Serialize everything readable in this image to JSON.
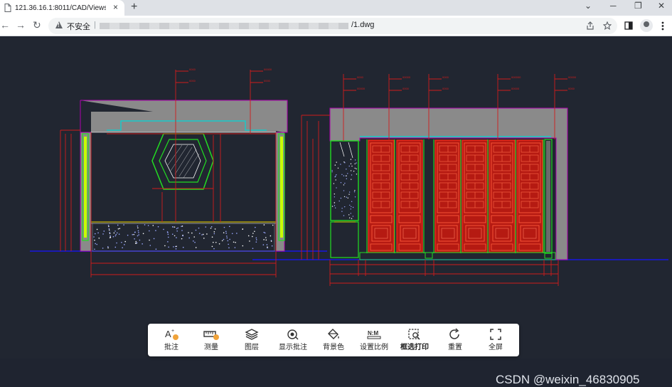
{
  "browser": {
    "tab_title": "121.36.16.1:8011/CAD/Views",
    "tab_close": "×",
    "new_tab": "+",
    "window": {
      "minimize": "─",
      "maximize": "❐",
      "close": "✕",
      "tab_search": "⌄"
    },
    "nav": {
      "back": "←",
      "forward": "→",
      "reload": "↻"
    },
    "security_label": "不安全",
    "address_separator": "|",
    "url_visible": "/1.dwg",
    "icons": {
      "share": "share-icon",
      "bookmark": "star-icon",
      "sidepanel": "sidepanel-icon",
      "profile": "profile-icon",
      "menu": "kebab-menu-icon"
    }
  },
  "toolbar": {
    "items": [
      {
        "label": "批注",
        "icon": "annotate-icon",
        "glyph": "A"
      },
      {
        "label": "测量",
        "icon": "measure-icon",
        "glyph": "▭"
      },
      {
        "label": "图层",
        "icon": "layers-icon",
        "glyph": "◈"
      },
      {
        "label": "显示批注",
        "icon": "show-annotation-icon",
        "glyph": "◎"
      },
      {
        "label": "背景色",
        "icon": "paint-bucket-icon",
        "glyph": "◇"
      },
      {
        "label": "设置比例",
        "icon": "scale-icon",
        "glyph": "N:M"
      },
      {
        "label": "框选打印",
        "icon": "box-print-icon",
        "glyph": "⬚"
      },
      {
        "label": "重置",
        "icon": "reset-icon",
        "glyph": "↻"
      },
      {
        "label": "全屏",
        "icon": "fullscreen-icon",
        "glyph": "⛶"
      }
    ]
  },
  "watermark": "CSDN @weixin_46830905",
  "cad_colors": {
    "background": "#212631",
    "wall": "#8a8a8a",
    "dimension": "#d01c1c",
    "panel": "#ff2a1a",
    "green": "#22dd22",
    "yellow_green": "#c8ff00",
    "cyan": "#00d8d8",
    "floor": "#1a1ab4",
    "magenta": "#b000b0"
  }
}
